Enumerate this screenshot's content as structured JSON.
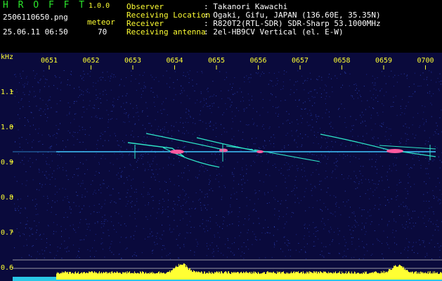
{
  "header": {
    "app_title": "H R O F F T",
    "version": "1.0.0",
    "filename": "2506110650.png",
    "timestamp": "25.06.11 06:50",
    "meteor_label": "meteor",
    "meteor_count": "70",
    "info": [
      {
        "label": "Observer",
        "value": ": Takanori Kawachi"
      },
      {
        "label": "Receiving Location",
        "value": ": Ogaki, Gifu, JAPAN (136.60E, 35.35N)"
      },
      {
        "label": "Receiver",
        "value": ": R820T2(RTL-SDR) SDR-Sharp 53.1000MHz"
      },
      {
        "label": "Receiving antenna",
        "value": ": 2el-HB9CV Vertical (el. E-W)"
      }
    ]
  },
  "spectrogram": {
    "unit_label": "kHz",
    "time_ticks": [
      "0651",
      "0652",
      "0653",
      "0654",
      "0655",
      "0656",
      "0657",
      "0658",
      "0659",
      "0700"
    ],
    "freq_ticks": [
      "1.1",
      "1.0",
      "0.9",
      "0.8",
      "0.7",
      "0.6"
    ],
    "colors": {
      "background": "#0a0a3c",
      "tick": "#ffff33",
      "carrier": "#3fc8ff",
      "meteor": "#ff5aa0",
      "meteor_head": "#2ee6c8",
      "noise_bar": "#ffff33",
      "noise_base": "#29c6e6"
    }
  }
}
